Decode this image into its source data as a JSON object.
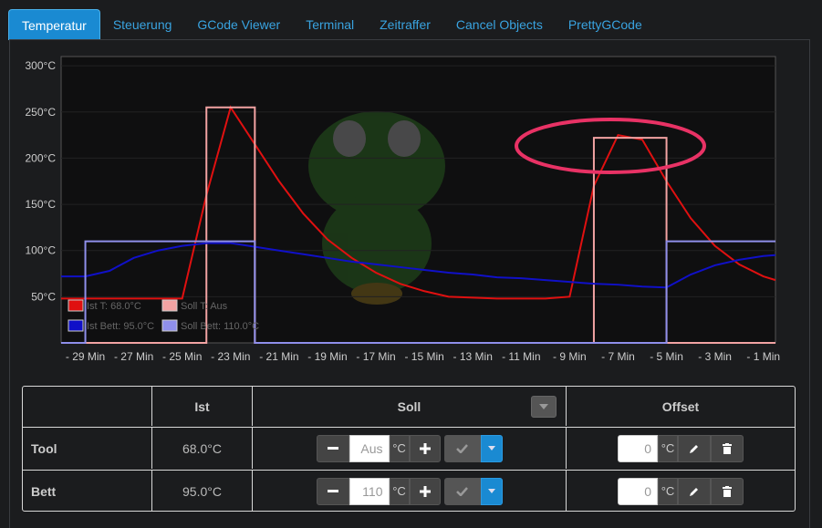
{
  "tabs": [
    "Temperatur",
    "Steuerung",
    "GCode Viewer",
    "Terminal",
    "Zeitraffer",
    "Cancel Objects",
    "PrettyGCode"
  ],
  "active_tab": "Temperatur",
  "colors": {
    "tool_actual": "#e01010",
    "tool_target": "#f2a3a3",
    "bed_actual": "#1010c8",
    "bed_target": "#8f8fea",
    "highlight": "#e83265",
    "accent": "#1a8ad2"
  },
  "chart_data": {
    "type": "line",
    "x": [
      -30,
      -29,
      -28,
      -27,
      -26,
      -25,
      -24,
      -23,
      -22,
      -21,
      -20,
      -19,
      -18,
      -17,
      -16,
      -15,
      -14,
      -13,
      -12,
      -11,
      -10,
      -9,
      -8,
      -7,
      -6,
      -5,
      -4,
      -3,
      -2,
      -1,
      -0.5
    ],
    "series": [
      {
        "name": "Ist T: 68.0°C",
        "values": [
          48,
          48,
          48,
          48,
          48,
          48,
          160,
          255,
          215,
          175,
          140,
          112,
          92,
          76,
          64,
          56,
          50,
          49,
          48,
          48,
          48,
          50,
          170,
          225,
          220,
          175,
          135,
          105,
          85,
          72,
          68
        ]
      },
      {
        "name": "Soll T: Aus",
        "values": [
          0,
          0,
          0,
          0,
          0,
          0,
          255,
          255,
          0,
          0,
          0,
          0,
          0,
          0,
          0,
          0,
          0,
          0,
          0,
          0,
          0,
          0,
          222,
          222,
          222,
          0,
          0,
          0,
          0,
          0,
          0
        ]
      },
      {
        "name": "Ist Bett: 95.0°C",
        "values": [
          72,
          72,
          78,
          92,
          100,
          105,
          108,
          108,
          104,
          100,
          96,
          92,
          88,
          85,
          82,
          79,
          76,
          74,
          71,
          70,
          68,
          66,
          64,
          63,
          61,
          60,
          74,
          84,
          90,
          94,
          95
        ]
      },
      {
        "name": "Soll Bett: 110.0°C",
        "values": [
          0,
          110,
          110,
          110,
          110,
          110,
          110,
          110,
          0,
          0,
          0,
          0,
          0,
          0,
          0,
          0,
          0,
          0,
          0,
          0,
          0,
          0,
          0,
          0,
          0,
          110,
          110,
          110,
          110,
          110,
          110
        ]
      }
    ],
    "y_ticks": [
      "300°C",
      "250°C",
      "200°C",
      "150°C",
      "100°C",
      "50°C"
    ],
    "x_ticks": [
      "- 29 Min",
      "- 27 Min",
      "- 25 Min",
      "- 23 Min",
      "- 21 Min",
      "- 19 Min",
      "- 17 Min",
      "- 15 Min",
      "- 13 Min",
      "- 11 Min",
      "- 9 Min",
      "- 7 Min",
      "- 5 Min",
      "- 3 Min",
      "- 1 Min"
    ],
    "ylim": [
      0,
      310
    ],
    "xlim": [
      -30,
      -0.5
    ],
    "legend": "bottom-left"
  },
  "table": {
    "headers": [
      "",
      "Ist",
      "Soll",
      "Offset"
    ],
    "rows": [
      {
        "name": "Tool",
        "actual": "68.0°C",
        "target": "Aus",
        "offset": "0"
      },
      {
        "name": "Bett",
        "actual": "95.0°C",
        "target": "110",
        "offset": "0"
      }
    ],
    "unit": "°C"
  }
}
